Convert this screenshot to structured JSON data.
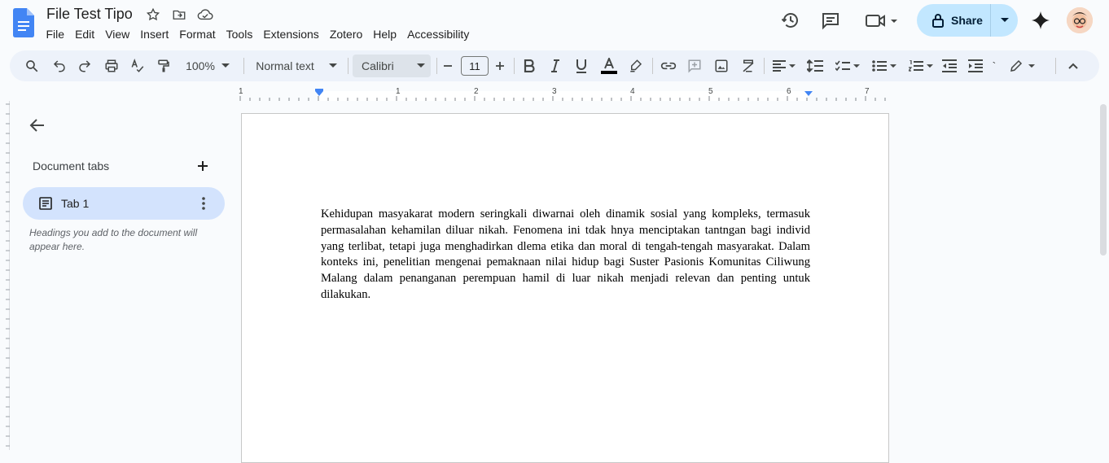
{
  "doc": {
    "title": "File Test Tipo"
  },
  "menu": [
    "File",
    "Edit",
    "View",
    "Insert",
    "Format",
    "Tools",
    "Extensions",
    "Zotero",
    "Help",
    "Accessibility"
  ],
  "header": {
    "share_label": "Share"
  },
  "toolbar": {
    "zoom": "100%",
    "style": "Normal text",
    "font": "Calibri",
    "font_size": "11"
  },
  "ruler": {
    "ticks": [
      "1",
      "1",
      "2",
      "3",
      "4",
      "5",
      "6",
      "7"
    ]
  },
  "sidebar": {
    "title": "Document tabs",
    "tabs": [
      {
        "label": "Tab 1"
      }
    ],
    "hint": "Headings you add to the document will appear here."
  },
  "document": {
    "paragraph": "Kehidupan masyakarat modern seringkali diwarnai oleh dinamik sosial yang kompleks, termasuk permasalahan kehamilan diluar nikah. Fenomena ini tdak hnya menciptakan tantngan bagi individ yang terlibat, tetapi juga menghadirkan dlema etika dan moral di tengah-tengah masyarakat. Dalam konteks ini, penelitian mengenai pemaknaan nilai hidup bagi Suster Pasionis Komunitas Ciliwung Malang dalam penanganan perempuan hamil di luar nikah menjadi relevan dan penting untuk dilakukan."
  },
  "colors": {
    "share_bg": "#c2e7ff",
    "toolbar_bg": "#edf2fa",
    "tab_active": "#d3e3fd",
    "docs_blue": "#4285f4"
  }
}
